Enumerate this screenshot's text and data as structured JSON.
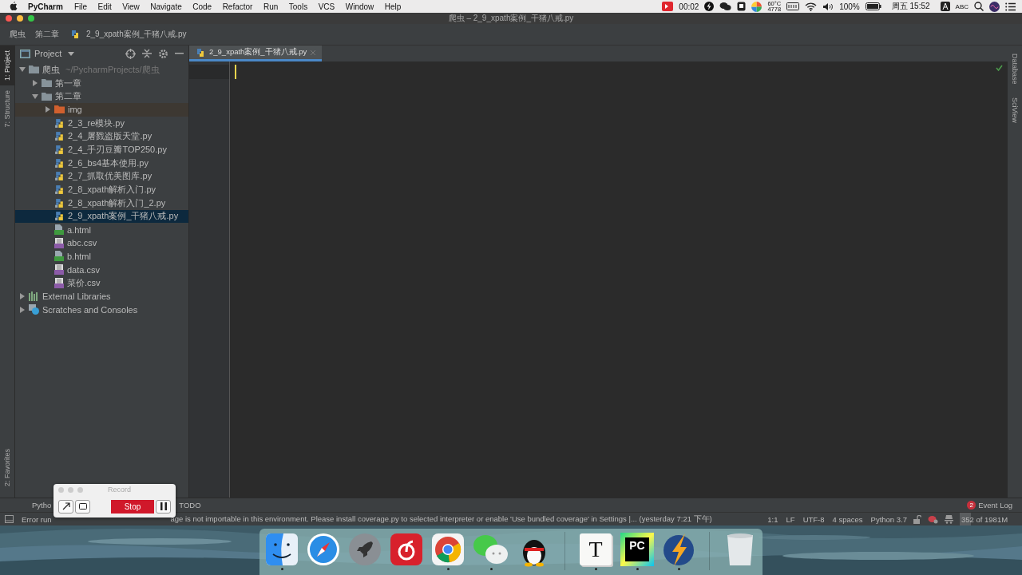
{
  "menu_bar": {
    "app": "PyCharm",
    "items": [
      "File",
      "Edit",
      "View",
      "Navigate",
      "Code",
      "Refactor",
      "Run",
      "Tools",
      "VCS",
      "Window",
      "Help"
    ],
    "recording_time": "00:02",
    "sensor": [
      "60°C",
      "4778"
    ],
    "battery": "100%",
    "clock": "周五 15:52",
    "input_source": "ABC"
  },
  "window": {
    "title": "爬虫 – 2_9_xpath案例_干猪八戒.py"
  },
  "breadcrumbs": [
    "爬虫",
    "第二章",
    "2_9_xpath案例_干猪八戒.py"
  ],
  "left_stripe": [
    {
      "label": "1: Project",
      "selected": true
    },
    {
      "label": "7: Structure",
      "selected": false
    },
    {
      "label": "2: Favorites",
      "selected": false
    }
  ],
  "project_panel": {
    "title": "Project",
    "tree": [
      {
        "name": "爬虫",
        "path": "~/PycharmProjects/爬虫",
        "kind": "folder",
        "expanded": true,
        "selected": false,
        "hovered": false,
        "children": [
          {
            "name": "第一章",
            "kind": "folder",
            "expanded": false,
            "selected": false,
            "hovered": false
          },
          {
            "name": "第二章",
            "kind": "folder",
            "expanded": true,
            "selected": false,
            "hovered": false,
            "children": [
              {
                "name": "img",
                "kind": "excluded-folder",
                "expanded": false,
                "selected": false,
                "hovered": true
              },
              {
                "name": "2_3_re模块.py",
                "kind": "python",
                "selected": false,
                "hovered": false
              },
              {
                "name": "2_4_屠戮盗版天堂.py",
                "kind": "python",
                "selected": false,
                "hovered": false
              },
              {
                "name": "2_4_手刃豆瓣TOP250.py",
                "kind": "python",
                "selected": false,
                "hovered": false
              },
              {
                "name": "2_6_bs4基本使用.py",
                "kind": "python",
                "selected": false,
                "hovered": false
              },
              {
                "name": "2_7_抓取优美图库.py",
                "kind": "python",
                "selected": false,
                "hovered": false
              },
              {
                "name": "2_8_xpath解析入门.py",
                "kind": "python",
                "selected": false,
                "hovered": false
              },
              {
                "name": "2_8_xpath解析入门_2.py",
                "kind": "python",
                "selected": false,
                "hovered": false
              },
              {
                "name": "2_9_xpath案例_干猪八戒.py",
                "kind": "python",
                "selected": true,
                "hovered": false
              },
              {
                "name": "a.html",
                "kind": "html",
                "selected": false,
                "hovered": false
              },
              {
                "name": "abc.csv",
                "kind": "csv",
                "selected": false,
                "hovered": false
              },
              {
                "name": "b.html",
                "kind": "html",
                "selected": false,
                "hovered": false
              },
              {
                "name": "data.csv",
                "kind": "csv",
                "selected": false,
                "hovered": false
              },
              {
                "name": "菜价.csv",
                "kind": "csv",
                "selected": false,
                "hovered": false
              }
            ]
          }
        ]
      },
      {
        "name": "External Libraries",
        "kind": "libraries",
        "expanded": false,
        "selected": false,
        "hovered": false
      },
      {
        "name": "Scratches and Consoles",
        "kind": "scratches",
        "expanded": false,
        "selected": false,
        "hovered": false
      }
    ]
  },
  "editor": {
    "tabs": [
      {
        "label": "2_9_xpath案例_干猪八戒.py",
        "selected": true
      }
    ]
  },
  "right_stripe": [
    "Database",
    "SciView"
  ],
  "tool_windows": [
    {
      "label": "Pytho"
    },
    {
      "label": "TODO"
    }
  ],
  "event_log": {
    "label": "Event Log",
    "count": "2"
  },
  "status_bar": {
    "message": [
      "Error run",
      "age is not importable in this environment. Please install coverage.py to selected interpreter or enable 'Use bundled coverage' in Settings |... (yesterday 7:21 下午)"
    ],
    "items": [
      "1:1",
      "LF",
      "UTF-8",
      "4 spaces",
      "Python 3.7"
    ],
    "memory": {
      "label": "352 of 1981M",
      "level": 0.18
    }
  },
  "record_window": {
    "title": "Record",
    "stop": "Stop"
  },
  "dock": {
    "apps": [
      {
        "kind": "finder",
        "running": true
      },
      {
        "kind": "safari",
        "running": false
      },
      {
        "kind": "launchpad",
        "running": false
      },
      {
        "kind": "music",
        "running": false
      },
      {
        "kind": "chrome",
        "running": true
      },
      {
        "kind": "wechat",
        "running": true
      },
      {
        "kind": "penguin",
        "running": false
      }
    ],
    "pinned": [
      {
        "kind": "typora",
        "label": "T",
        "running": true
      },
      {
        "kind": "pycharm",
        "label": "PC",
        "running": true
      },
      {
        "kind": "thunder",
        "running": true
      }
    ]
  }
}
